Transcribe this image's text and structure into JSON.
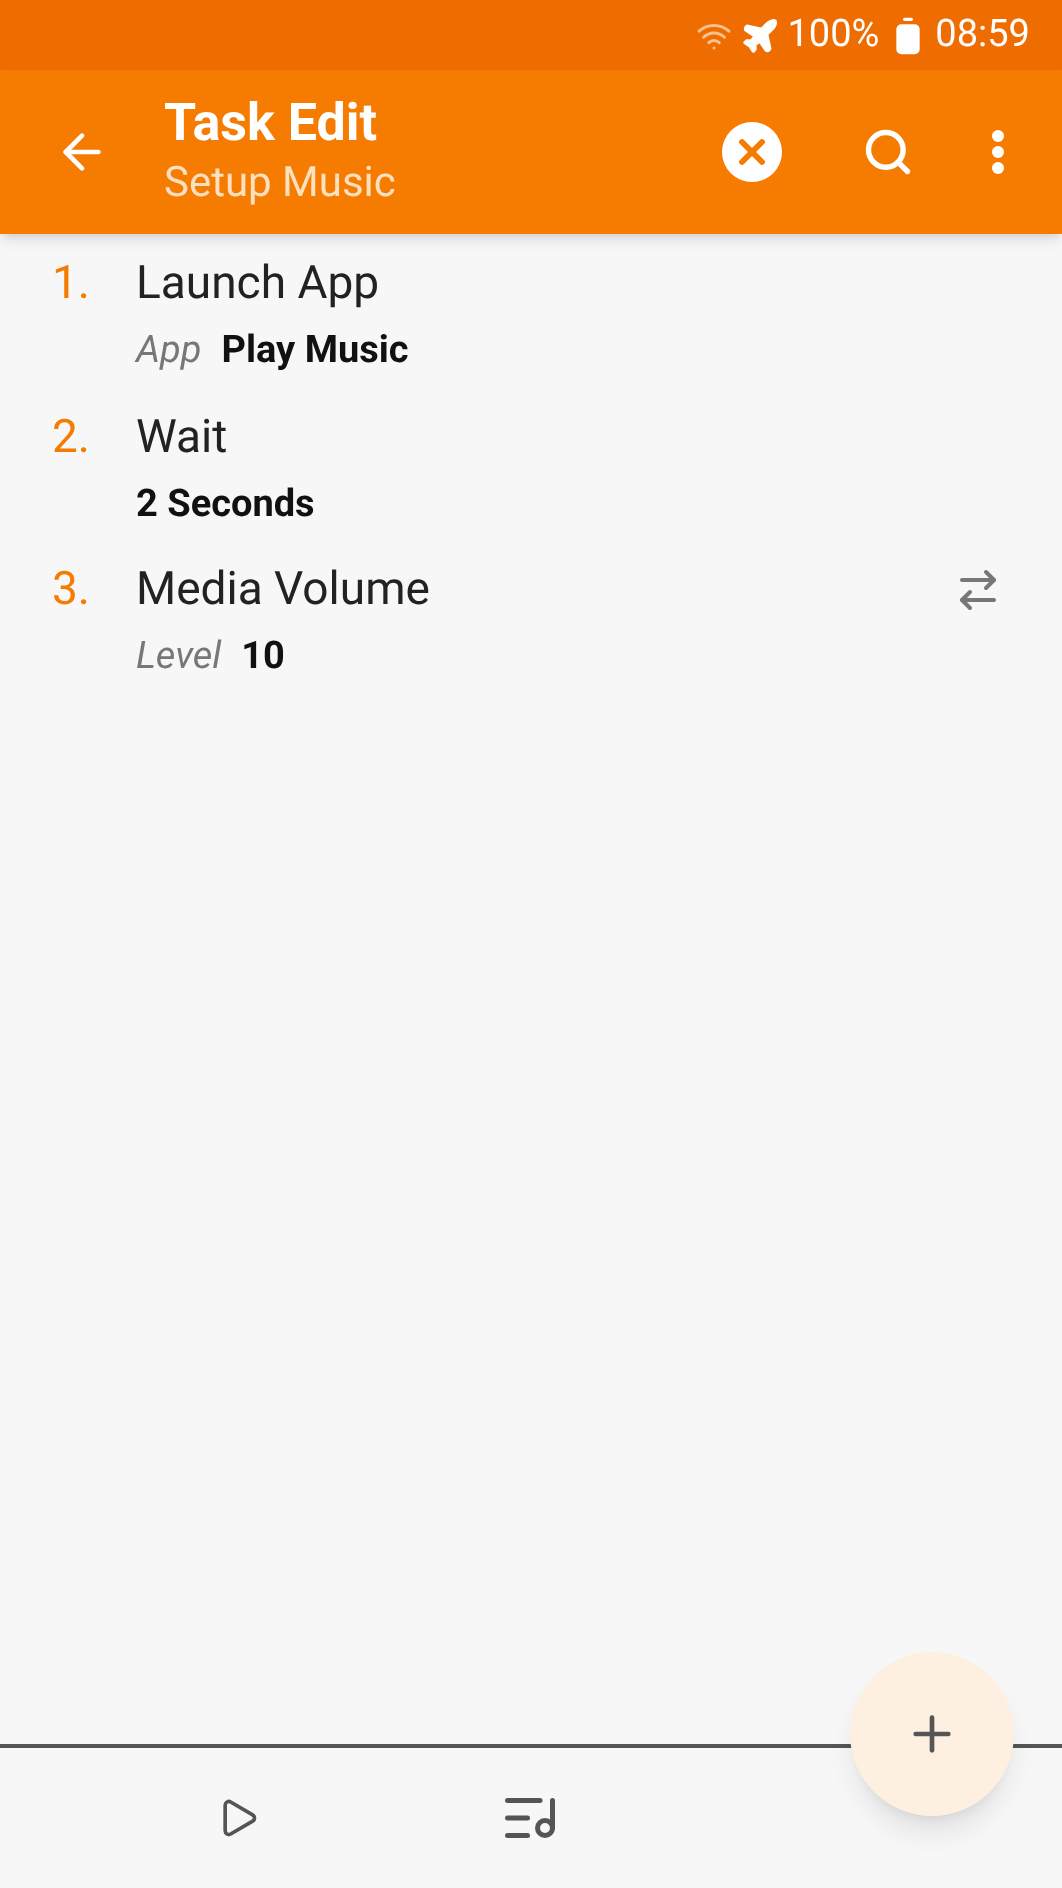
{
  "status_bar": {
    "battery": "100%",
    "time": "08:59"
  },
  "toolbar": {
    "title": "Task Edit",
    "subtitle": "Setup Music"
  },
  "steps": [
    {
      "number": "1.",
      "title": "Launch App",
      "label": "App",
      "value": "Play Music",
      "switchable": false
    },
    {
      "number": "2.",
      "title": "Wait",
      "value": "2 Seconds",
      "switchable": false
    },
    {
      "number": "3.",
      "title": "Media Volume",
      "label": "Level",
      "value": "10",
      "switchable": true
    }
  ]
}
